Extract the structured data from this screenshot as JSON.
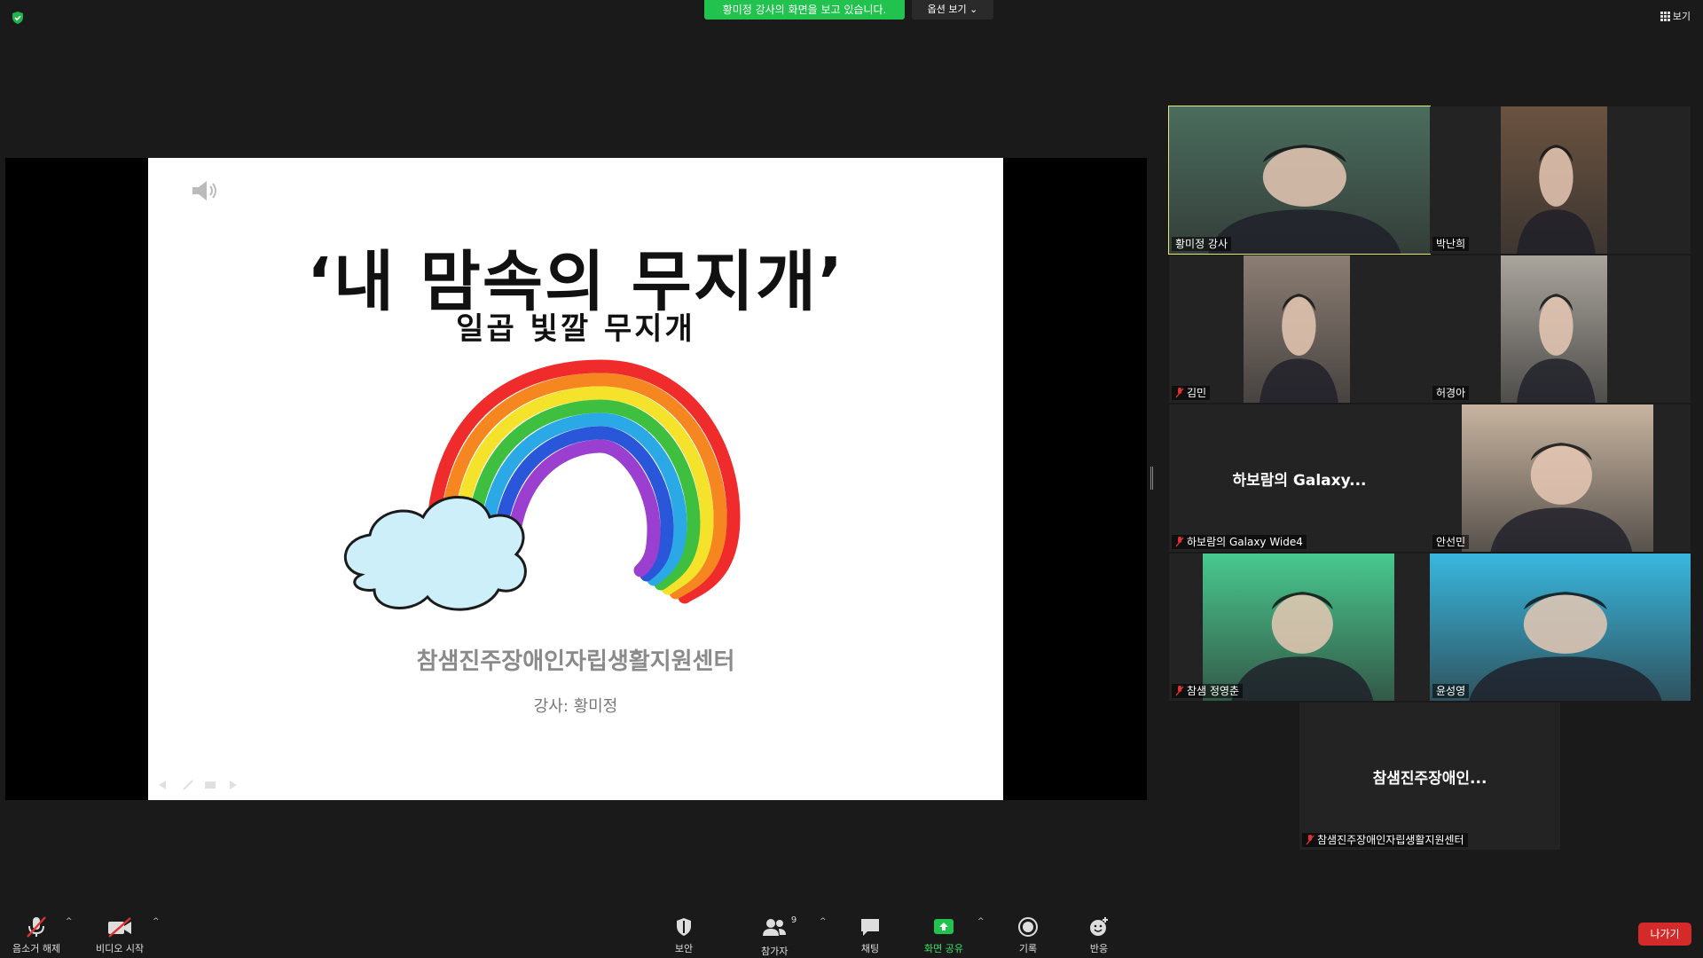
{
  "top": {
    "share_banner": "황미정 강사의 화면을 보고 있습니다.",
    "view_options": "옵션 보기 ⌄",
    "view_button": "보기"
  },
  "slide": {
    "title": "‘내 맘속의 무지개’",
    "subtitle": "일곱 빛깔 무지개",
    "organization": "참샘진주장애인자립생활지원센터",
    "teacher": "강사: 황미정"
  },
  "participants": [
    {
      "name": "황미정 강사",
      "muted": false,
      "active": true,
      "bg": "#4b6d5e"
    },
    {
      "name": "박난희",
      "muted": false,
      "active": false,
      "bg": "#6b5340"
    },
    {
      "name": "김민",
      "muted": true,
      "active": false,
      "bg": "#8c7e74"
    },
    {
      "name": "허경아",
      "muted": false,
      "active": false,
      "bg": "#a9a49c"
    },
    {
      "name": "하보람의 Galaxy Wide4",
      "muted": true,
      "active": false,
      "center_label": "하보람의 Galaxy..."
    },
    {
      "name": "안선민",
      "muted": false,
      "active": false,
      "bg": "#c8b4a0"
    },
    {
      "name": "참샘 정영춘",
      "muted": true,
      "active": false,
      "bg": "#48c98f"
    },
    {
      "name": "윤성영",
      "muted": false,
      "active": false,
      "bg": "#38b7de"
    },
    {
      "name": "참샘진주장애인자립생활지원센터",
      "muted": true,
      "active": false,
      "center_label": "참샘진주장애인..."
    }
  ],
  "toolbar": {
    "unmute": "음소거 해제",
    "start_video": "비디오 시작",
    "security": "보안",
    "participants": "참가자",
    "participants_count": "9",
    "chat": "채팅",
    "share_screen": "화면 공유",
    "record": "기록",
    "reactions": "반응",
    "leave": "나가기"
  },
  "colors": {
    "share_banner": "#21c24d",
    "active_speaker_border": "#e6ea6a",
    "leave_button": "#d42a2a"
  }
}
